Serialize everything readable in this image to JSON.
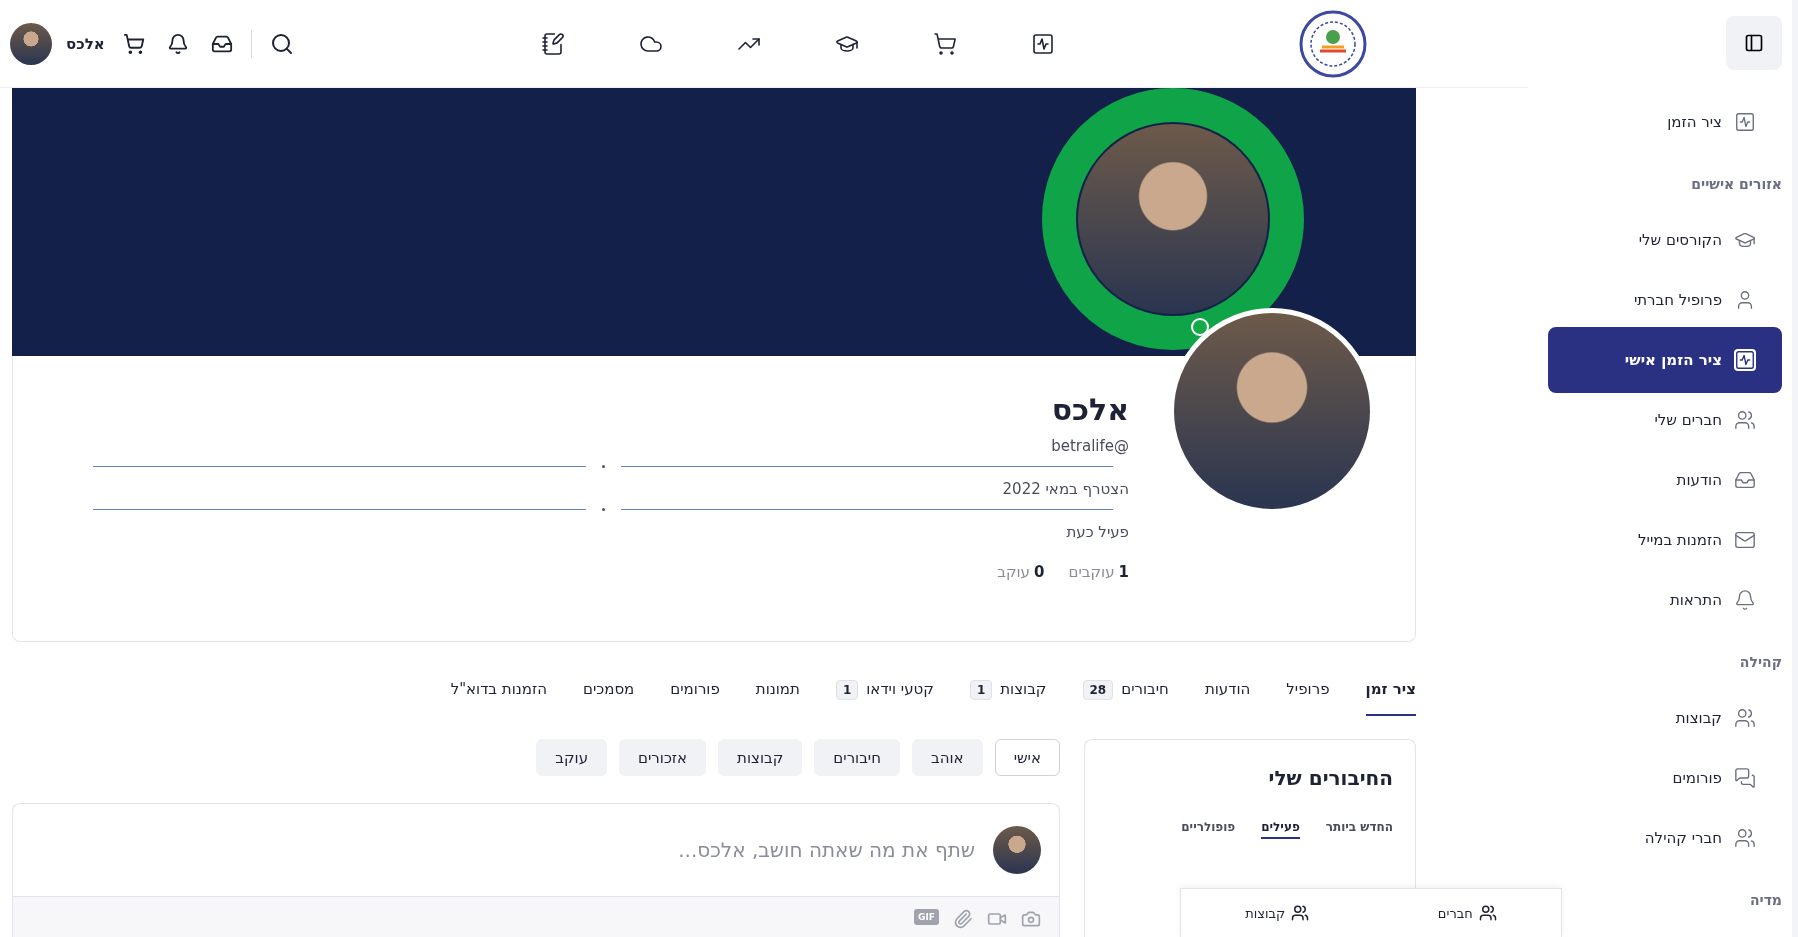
{
  "topbar": {
    "user_name": "אלכס"
  },
  "sidebar": {
    "items": [
      {
        "kind": "link",
        "label": "ציר הזמן",
        "selected": false
      },
      {
        "kind": "heading",
        "label": "אזורים אישיים"
      },
      {
        "kind": "link",
        "label": "הקורסים שלי",
        "selected": false
      },
      {
        "kind": "link",
        "label": "פרופיל חברתי",
        "selected": false
      },
      {
        "kind": "link",
        "label": "ציר הזמן אישי",
        "selected": true
      },
      {
        "kind": "link",
        "label": "חברים שלי",
        "selected": false
      },
      {
        "kind": "link",
        "label": "הודעות",
        "selected": false
      },
      {
        "kind": "link",
        "label": "הזמנות במייל",
        "selected": false
      },
      {
        "kind": "link",
        "label": "התראות",
        "selected": false
      },
      {
        "kind": "heading",
        "label": "קהילה"
      },
      {
        "kind": "link",
        "label": "קבוצות",
        "selected": false
      },
      {
        "kind": "link",
        "label": "פורומים",
        "selected": false
      },
      {
        "kind": "link",
        "label": "חברי קהילה",
        "selected": false
      },
      {
        "kind": "heading",
        "label": "מדיה"
      }
    ]
  },
  "profile": {
    "name": "אלכס",
    "handle": "@betralife",
    "joined": "הצטרף במאי 2022",
    "status": "פעיל כעת",
    "online": true,
    "stats": [
      {
        "count": "1",
        "label": "עוקבים"
      },
      {
        "count": "0",
        "label": "עוקב"
      }
    ]
  },
  "tabs": [
    {
      "label": "ציר זמן",
      "selected": true
    },
    {
      "label": "פרופיל",
      "selected": false
    },
    {
      "label": "הודעות",
      "selected": false
    },
    {
      "label": "חיבורים",
      "count": "28",
      "selected": false
    },
    {
      "label": "קבוצות",
      "count": "1",
      "selected": false
    },
    {
      "label": "קטעי וידאו",
      "count": "1",
      "selected": false
    },
    {
      "label": "תמונות",
      "selected": false
    },
    {
      "label": "פורומים",
      "selected": false
    },
    {
      "label": "מסמכים",
      "selected": false
    },
    {
      "label": "הזמנות בדוא\"ל",
      "selected": false
    }
  ],
  "filters": [
    {
      "label": "אישי",
      "selected": true
    },
    {
      "label": "אוהב",
      "selected": false
    },
    {
      "label": "חיבורים",
      "selected": false
    },
    {
      "label": "קבוצות",
      "selected": false
    },
    {
      "label": "אזכורים",
      "selected": false
    },
    {
      "label": "עוקב",
      "selected": false
    }
  ],
  "composer": {
    "placeholder": "שתף את מה שאתה חושב, אלכס...",
    "gif_label": "GIF"
  },
  "connections_widget": {
    "title": "החיבורים שלי",
    "tabs": [
      {
        "label": "החדש ביותר",
        "selected": false
      },
      {
        "label": "פעילים",
        "selected": true
      },
      {
        "label": "פופולריים",
        "selected": false
      }
    ]
  },
  "bottom_bar": {
    "items": [
      {
        "label": "חברים"
      },
      {
        "label": "קבוצות"
      }
    ]
  }
}
